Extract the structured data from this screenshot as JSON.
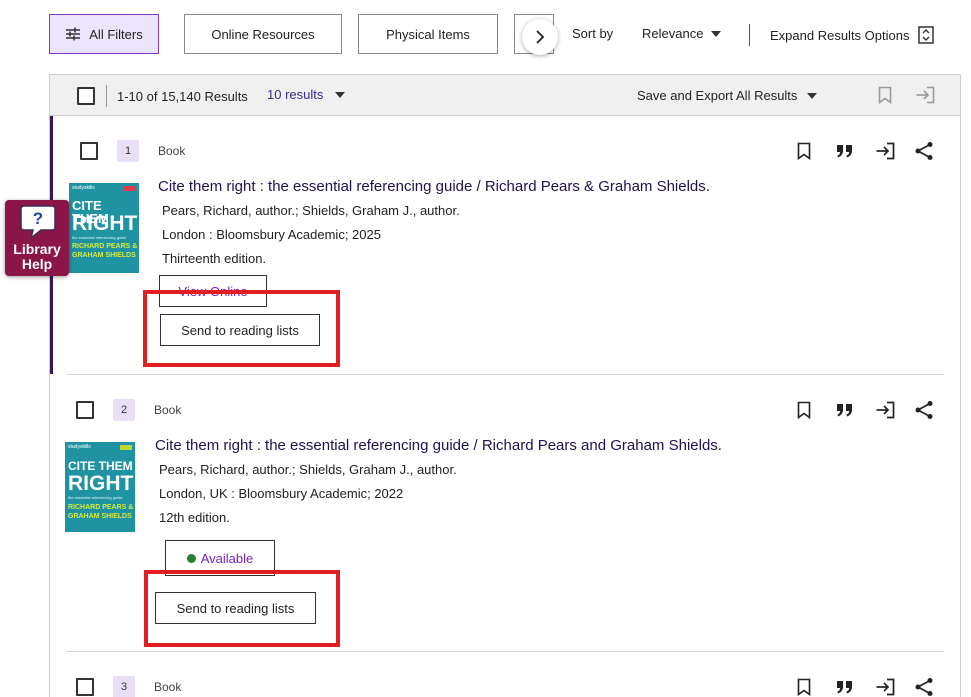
{
  "toolbar": {
    "all_filters": "All Filters",
    "online_resources": "Online Resources",
    "physical_items": "Physical Items",
    "sort_label": "Sort by",
    "sort_value": "Relevance",
    "expand_options": "Expand Results Options"
  },
  "results_header": {
    "count": "1-10 of 15,140 Results",
    "per_page": "10 results",
    "export": "Save and Export All Results"
  },
  "records": [
    {
      "number": "1",
      "type": "Book",
      "title": "Cite them right : the essential referencing guide / Richard Pears & Graham Shields.",
      "authors": "Pears, Richard, author.; Shields, Graham J., author.",
      "publisher": "London : Bloomsbury Academic; 2025",
      "edition": "Thirteenth edition.",
      "access_label": "View Online",
      "reading_list_label": "Send to reading lists",
      "cover": {
        "brand": "studyskills",
        "line1": "CITE THEM",
        "line2": "RIGHT",
        "subtitle": "the essential referencing guide",
        "author1": "RICHARD PEARS &",
        "author2": "GRAHAM SHIELDS"
      }
    },
    {
      "number": "2",
      "type": "Book",
      "title": "Cite them right : the essential referencing guide / Richard Pears and Graham Shields.",
      "authors": "Pears, Richard, author.; Shields, Graham J., author.",
      "publisher": "London, UK : Bloomsbury Academic; 2022",
      "edition": "12th edition.",
      "access_label": "Available",
      "reading_list_label": "Send to reading lists",
      "cover": {
        "brand": "studyskills",
        "line1": "CITE THEM",
        "line2": "RIGHT",
        "subtitle": "the essential referencing guide",
        "author1": "RICHARD PEARS &",
        "author2": "GRAHAM SHIELDS"
      }
    },
    {
      "number": "3",
      "type": "Book"
    }
  ],
  "help_widget": {
    "line1": "Library",
    "line2": "Help",
    "symbol": "?"
  },
  "colors": {
    "accent": "#7a3fc1",
    "highlight": "#e02020",
    "available": "#2e7d32",
    "help": "#8c1547"
  },
  "icons": [
    "filter-sliders-icon",
    "chevron-right-icon",
    "caret-down-icon",
    "expand-options-icon",
    "bookmark-icon",
    "citation-quote-icon",
    "export-arrow-icon",
    "share-icon"
  ]
}
